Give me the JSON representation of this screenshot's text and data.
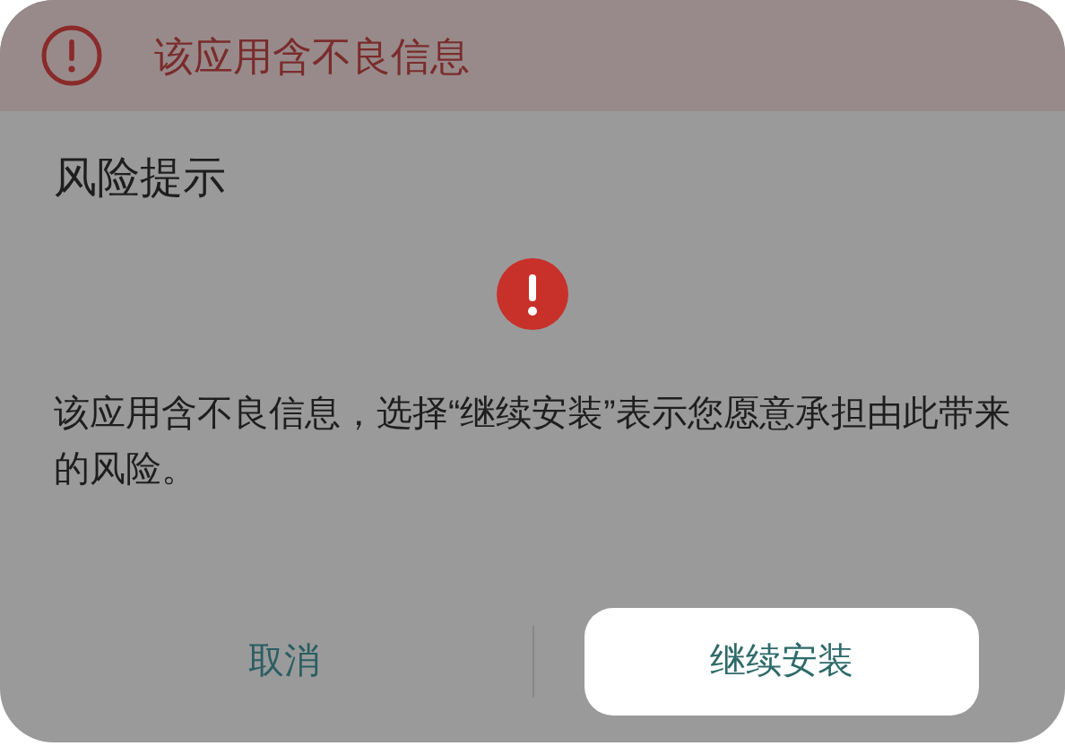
{
  "banner": {
    "text": "该应用含不良信息"
  },
  "dialog": {
    "title": "风险提示",
    "message": "该应用含不良信息，选择“继续安装”表示您愿意承担由此带来的风险。"
  },
  "buttons": [
    {
      "label": "取消",
      "selected": false
    },
    {
      "label": "继续安装",
      "selected": true
    }
  ]
}
